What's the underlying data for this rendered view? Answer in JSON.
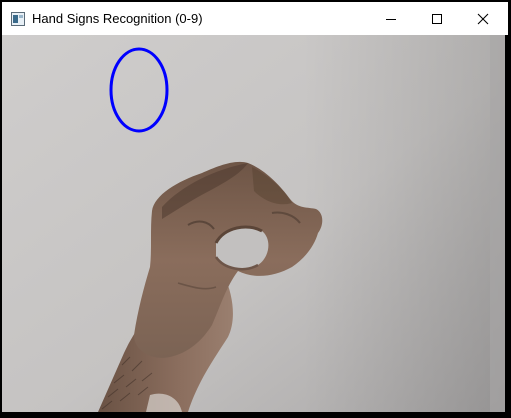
{
  "window": {
    "title": "Hand Signs Recognition (0-9)",
    "controls": {
      "minimize_icon": "minimize-icon",
      "maximize_icon": "maximize-icon",
      "close_icon": "close-icon"
    }
  },
  "camera_feed": {
    "overlay_color": "#0000ff",
    "background_color": "#c4c2c1"
  }
}
